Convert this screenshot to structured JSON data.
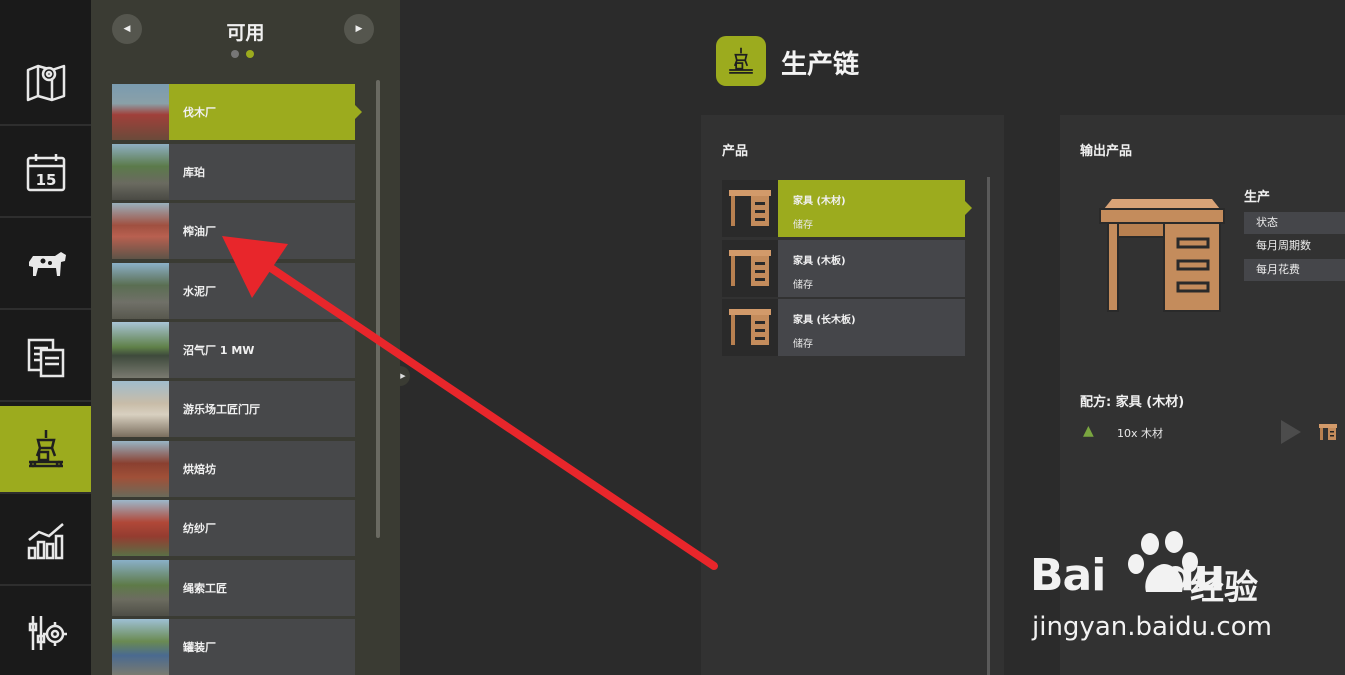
{
  "list": {
    "title": "可用",
    "prev_arrow": "◀",
    "next_arrow": "▶",
    "items": [
      {
        "label": "伐木厂",
        "selected": true
      },
      {
        "label": "库珀",
        "selected": false
      },
      {
        "label": "榨油厂",
        "selected": false
      },
      {
        "label": "水泥厂",
        "selected": false
      },
      {
        "label": "沼气厂 1 MW",
        "selected": false
      },
      {
        "label": "游乐场工匠门厅",
        "selected": false
      },
      {
        "label": "烘焙坊",
        "selected": false
      },
      {
        "label": "纺纱厂",
        "selected": false
      },
      {
        "label": "绳索工匠",
        "selected": false
      },
      {
        "label": "罐装厂",
        "selected": false
      }
    ],
    "handle": "▶"
  },
  "nav": {
    "items": [
      {
        "icon": "map-icon"
      },
      {
        "icon": "calendar-icon",
        "text": "15"
      },
      {
        "icon": "animals-icon"
      },
      {
        "icon": "contracts-icon"
      },
      {
        "icon": "production-icon",
        "active": true
      },
      {
        "icon": "stats-icon"
      },
      {
        "icon": "settings-icon"
      }
    ]
  },
  "main": {
    "title": "生产链",
    "products": {
      "title": "产品",
      "items": [
        {
          "name": "家具 (木材)",
          "status": "储存",
          "selected": true
        },
        {
          "name": "家具 (木板)",
          "status": "储存",
          "selected": false
        },
        {
          "name": "家具 (长木板)",
          "status": "储存",
          "selected": false
        }
      ]
    },
    "output": {
      "title": "输出产品",
      "production_label": "生产",
      "stats": [
        "状态",
        "每月周期数",
        "每月花费"
      ],
      "recipe_title": "配方: 家具 (木材)",
      "recipe_input": "10x 木材"
    }
  },
  "watermark": {
    "logo": "Bai",
    "logo_du": "du",
    "cn": "经验",
    "url": "jingyan.baidu.com"
  },
  "colors": {
    "accent": "#9cab1e",
    "arrow": "#e8262b"
  }
}
